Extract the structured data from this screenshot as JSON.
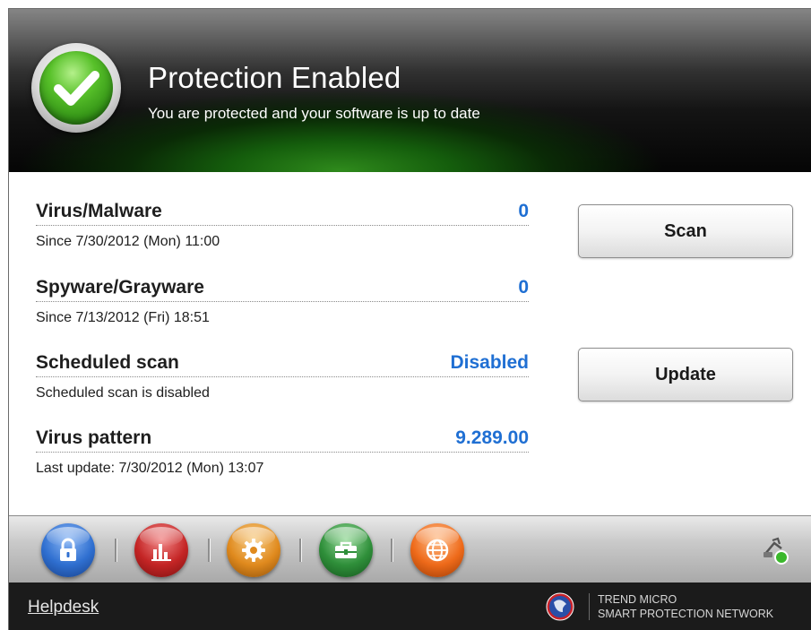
{
  "header": {
    "title": "Protection Enabled",
    "subtitle": "You are protected and your software is up to date",
    "status_icon": "green-checkmark-shield"
  },
  "stats": [
    {
      "label": "Virus/Malware",
      "value": "0",
      "sub": "Since 7/30/2012 (Mon) 11:00"
    },
    {
      "label": "Spyware/Grayware",
      "value": "0",
      "sub": "Since 7/13/2012 (Fri) 18:51"
    },
    {
      "label": "Scheduled scan",
      "value": "Disabled",
      "sub": "Scheduled scan is disabled"
    },
    {
      "label": "Virus pattern",
      "value": "9.289.00",
      "sub": "Last update: 7/30/2012 (Mon) 13:07"
    }
  ],
  "buttons": {
    "scan": "Scan",
    "update": "Update"
  },
  "toolbar": {
    "items": [
      {
        "icon": "lock-icon",
        "color": "#2f6fd0"
      },
      {
        "icon": "bar-chart-icon",
        "color": "#c42525"
      },
      {
        "icon": "gear-icon",
        "color": "#e08a1e"
      },
      {
        "icon": "toolbox-icon",
        "color": "#2f8f3a"
      },
      {
        "icon": "globe-icon",
        "color": "#ee6a1a"
      }
    ],
    "network_status_icon": "network-connected-icon"
  },
  "footer": {
    "helpdesk": "Helpdesk",
    "brand_line1": "TREND MICRO",
    "brand_line2": "SMART PROTECTION NETWORK"
  },
  "colors": {
    "accent_value": "#1f6fd3",
    "header_glow": "#2f8a1c"
  }
}
